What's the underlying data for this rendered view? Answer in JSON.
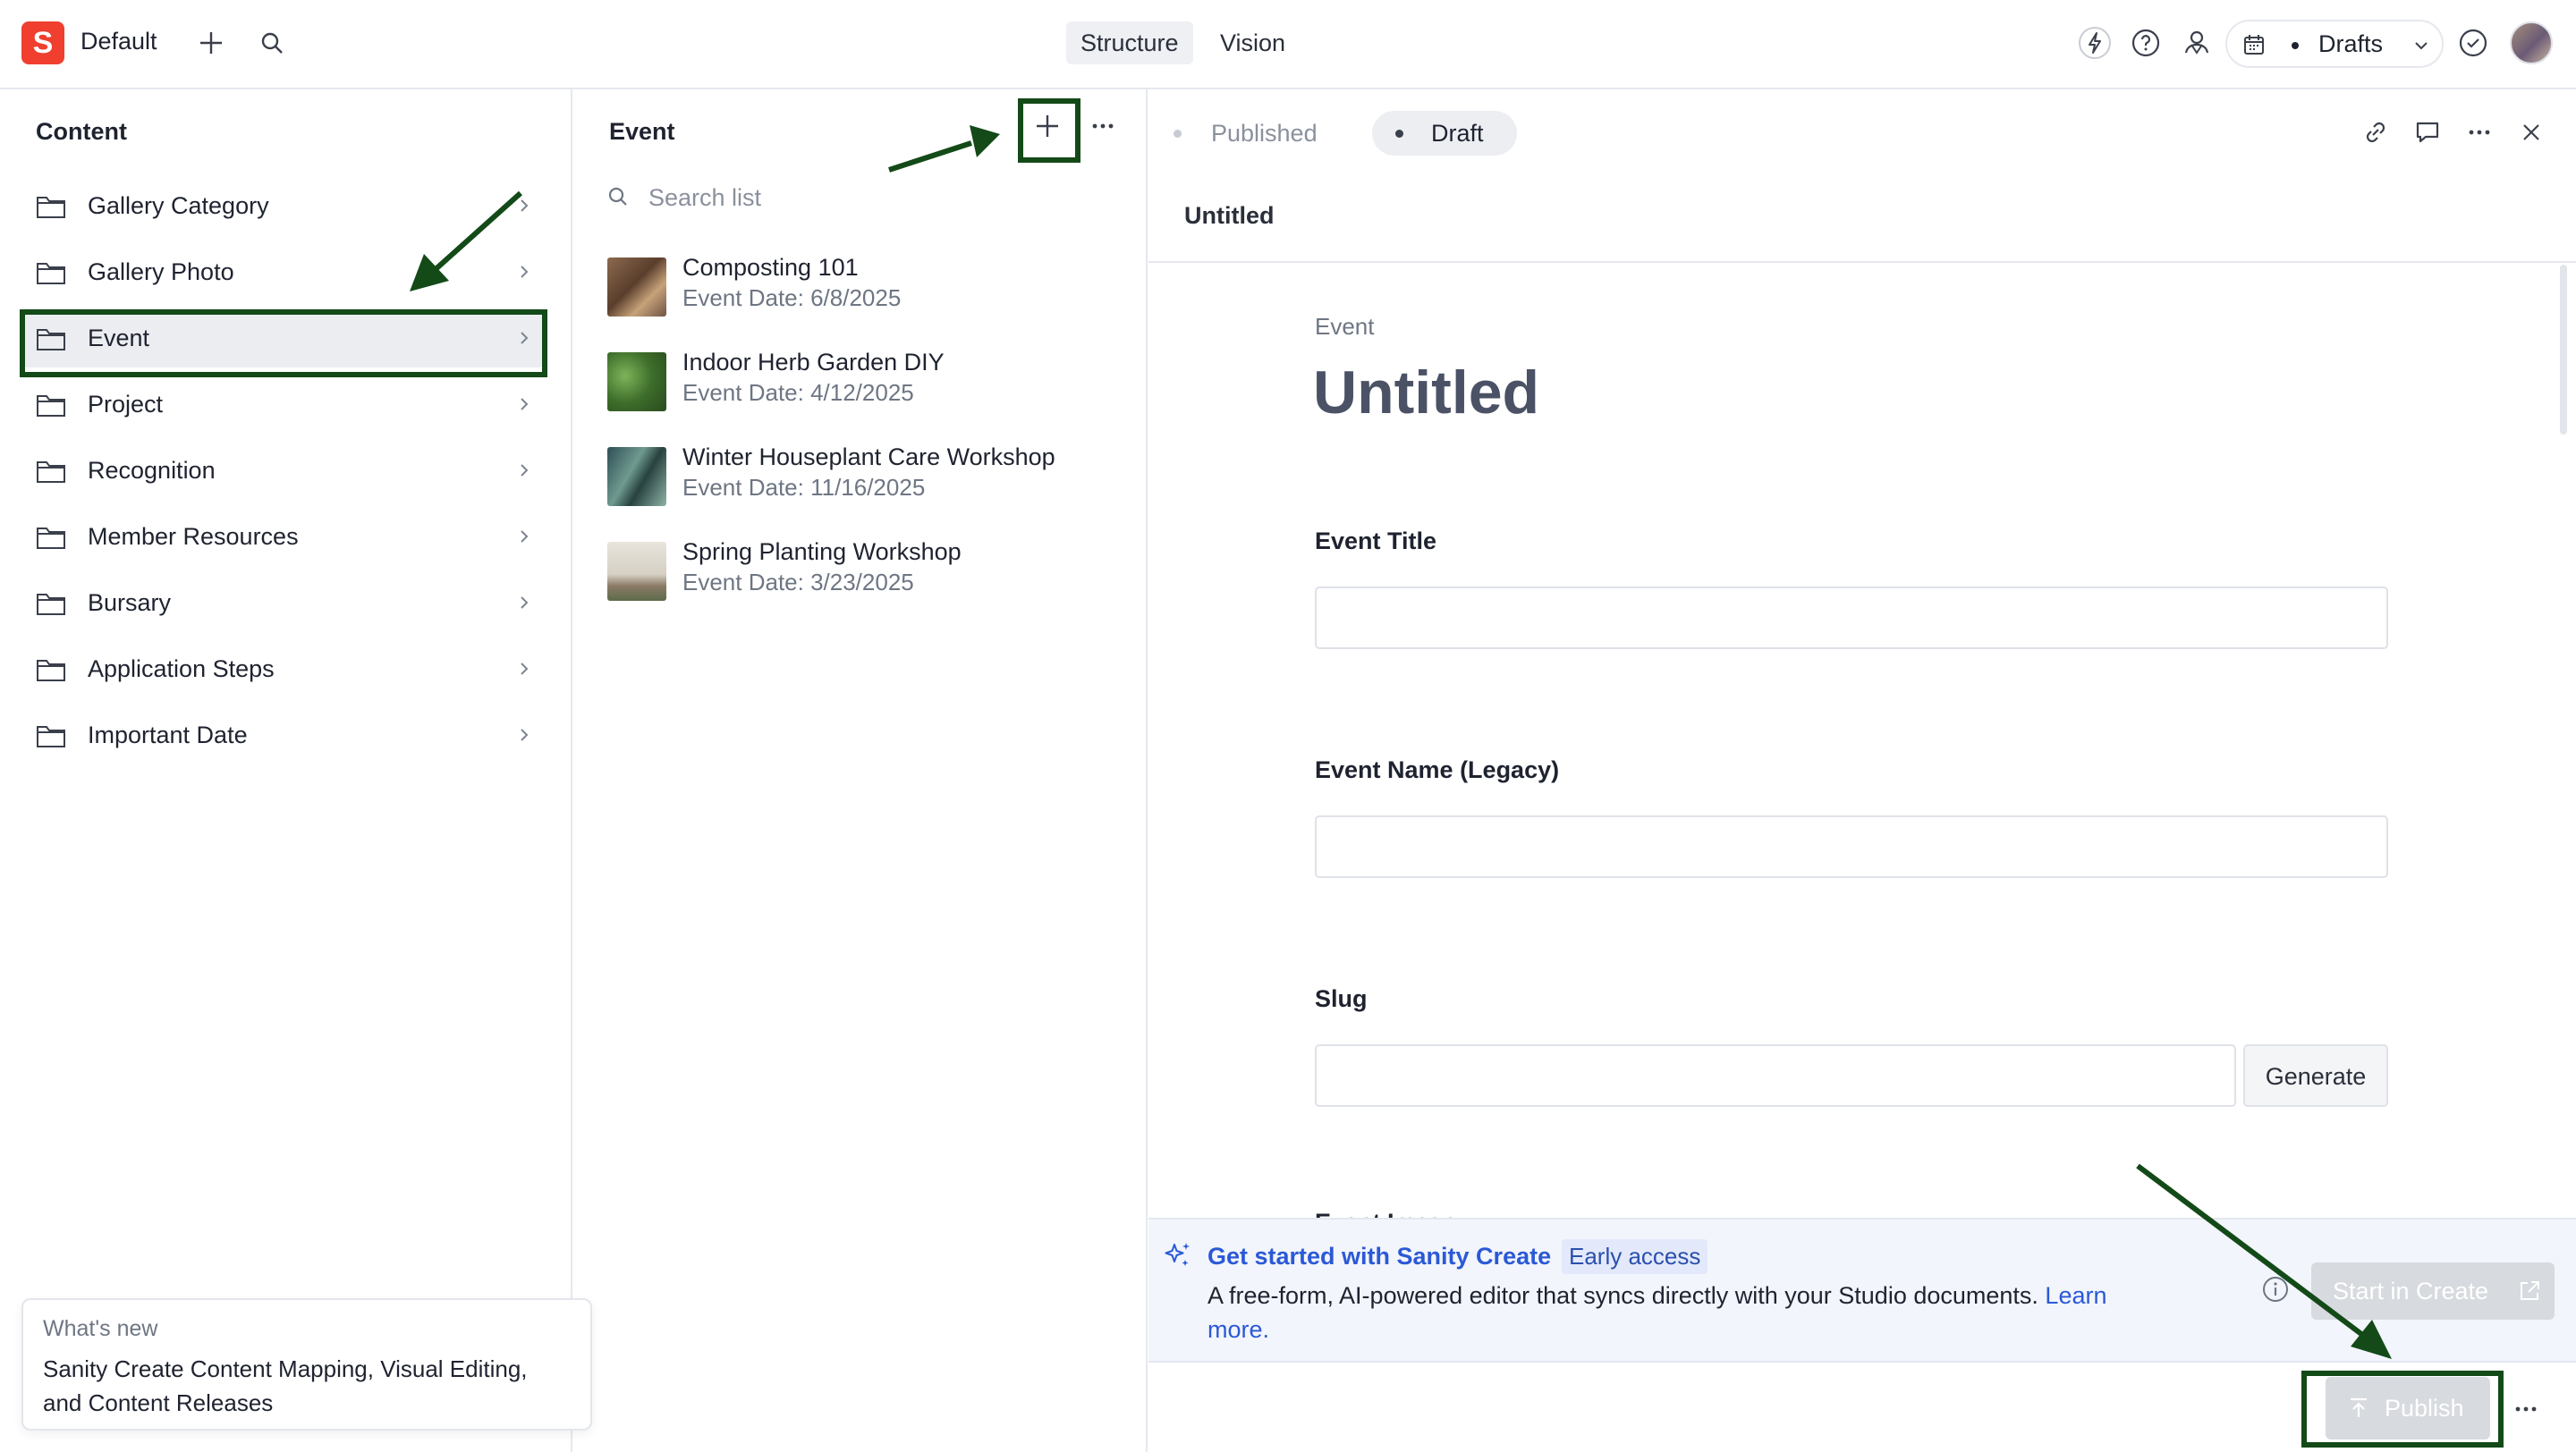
{
  "topbar": {
    "logo_letter": "S",
    "workspace": "Default",
    "tabs": [
      "Structure",
      "Vision"
    ],
    "perspective": "Drafts"
  },
  "content_pane": {
    "title": "Content",
    "items": [
      {
        "label": "Gallery Category"
      },
      {
        "label": "Gallery Photo"
      },
      {
        "label": "Event"
      },
      {
        "label": "Project"
      },
      {
        "label": "Recognition"
      },
      {
        "label": "Member Resources"
      },
      {
        "label": "Bursary"
      },
      {
        "label": "Application Steps"
      },
      {
        "label": "Important Date"
      }
    ]
  },
  "event_pane": {
    "title": "Event",
    "search_placeholder": "Search list",
    "documents": [
      {
        "title": "Composting 101",
        "subtitle": "Event Date: 6/8/2025"
      },
      {
        "title": "Indoor Herb Garden DIY",
        "subtitle": "Event Date: 4/12/2025"
      },
      {
        "title": "Winter Houseplant Care Workshop",
        "subtitle": "Event Date: 11/16/2025"
      },
      {
        "title": "Spring Planting Workshop",
        "subtitle": "Event Date: 3/23/2025"
      }
    ]
  },
  "editor": {
    "status_tabs": [
      "Published",
      "Draft"
    ],
    "header_title": "Untitled",
    "doc_type": "Event",
    "doc_title": "Untitled",
    "fields": {
      "event_title_label": "Event Title",
      "event_name_label": "Event Name (Legacy)",
      "slug_label": "Slug",
      "generate_label": "Generate",
      "partial_label": "Event Image"
    },
    "banner": {
      "title": "Get started with Sanity Create",
      "badge": "Early access",
      "text_before_link": "A free-form, AI-powered editor that syncs directly with your Studio documents. ",
      "link_part1": "Learn",
      "link_part2": "more.",
      "button": "Start in Create"
    },
    "publish_label": "Publish"
  },
  "whats_new": {
    "title": "What's new",
    "line1": "Sanity Create Content Mapping, Visual Editing,",
    "line2": "and Content Releases"
  },
  "colors": {
    "brand": "#f03e2f",
    "annotation": "#134a18",
    "link": "#2b59d6"
  }
}
